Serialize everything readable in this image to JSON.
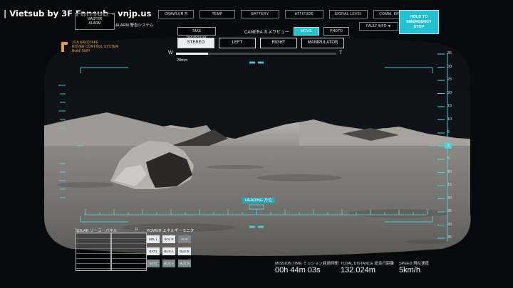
{
  "subtitle_credit": "| Vietsub by 3F Fansub - vnjp.us",
  "status_bar": {
    "items": [
      "CRAWLER R",
      "TEMP",
      "BATTERY",
      "ATTITUDE",
      "SIGNAL LEVEL",
      "COMM. ERRS"
    ],
    "fault_info": "FAULT INFO ▼"
  },
  "emergency_stop": {
    "line1": "HOLD TO",
    "line2": "EMERGENCY",
    "line3": "STOP"
  },
  "master_alarm": {
    "line1": "MASTER",
    "line2": "ALARM",
    "side_label": "ALARM 警告システム"
  },
  "camera": {
    "panorama_label": "TAKE PANORAMA",
    "label": "CAMERA カメラビュー",
    "modes": [
      {
        "label": "MOVIE",
        "active": true
      },
      {
        "label": "PHOTO",
        "active": false
      }
    ],
    "views": [
      {
        "label": "STEREO",
        "active": true
      },
      {
        "label": "LEFT",
        "active": false
      },
      {
        "label": "RIGHT",
        "active": false
      },
      {
        "label": "MANIPULATOR",
        "active": false
      }
    ]
  },
  "zoom": {
    "wide_label": "W",
    "tele_label": "T",
    "value_text": "28mm",
    "level_fraction": 0.2
  },
  "logo": {
    "line1": "JOA NAVOTAKE",
    "line2": "ROVER CONTROL SYSTEM",
    "line3": "Build: 5894"
  },
  "right_scale": [
    "35",
    "30",
    "25",
    "20",
    "15",
    "10",
    "5",
    "0",
    "5",
    "10",
    "15",
    "20",
    "25",
    "30",
    "35"
  ],
  "heading": {
    "label": "HEADING 方位"
  },
  "solar": {
    "label": "SOLAR ソーラーパネル",
    "left": "L",
    "right": "R"
  },
  "power": {
    "label": "POWER エネルギーモニタ",
    "buttons": [
      {
        "label": "SOL L",
        "active": true
      },
      {
        "label": "SOL R",
        "active": true
      },
      {
        "label": "AUX",
        "active": false
      },
      {
        "label": "BAT1",
        "active": true
      },
      {
        "label": "BUS A",
        "active": true
      },
      {
        "label": "BUS B",
        "active": true
      },
      {
        "label": "BAT2",
        "active": false
      },
      {
        "label": "BUS A",
        "active": false
      },
      {
        "label": "BUS B",
        "active": false
      }
    ]
  },
  "telemetry": {
    "mission_time_label": "MISSION TIME ミッション経過時間",
    "mission_time_value": "00h 44m 03s",
    "distance_label": "TOTAL DISTANCE 総走行距離",
    "distance_value": "132.024m",
    "speed_label": "SPEED 現在速度",
    "speed_value": "5km/h"
  },
  "colors": {
    "accent": "#21c2d2",
    "logo": "#e79a33",
    "hud_line": "#49d3e0"
  }
}
